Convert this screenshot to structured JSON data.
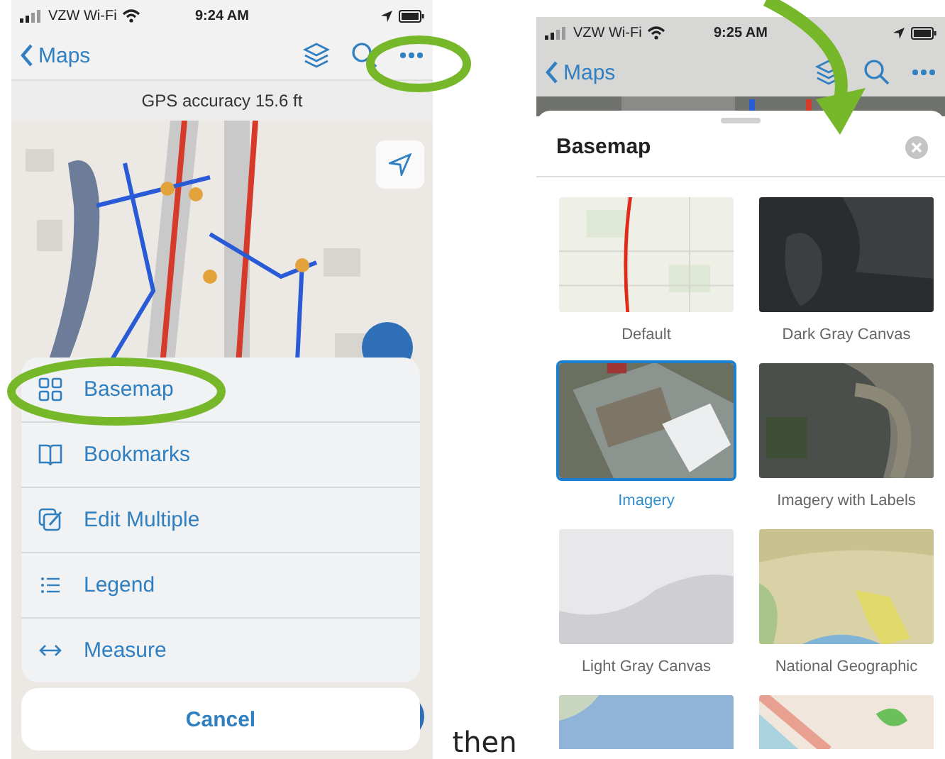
{
  "left_phone": {
    "status_bar": {
      "carrier": "VZW Wi-Fi",
      "time": "9:24 AM"
    },
    "nav_bar": {
      "back": "Maps"
    },
    "gps_banner": "GPS accuracy 15.6 ft",
    "menu": [
      {
        "label": "Basemap"
      },
      {
        "label": "Bookmarks"
      },
      {
        "label": "Edit Multiple"
      },
      {
        "label": "Legend"
      },
      {
        "label": "Measure"
      }
    ],
    "cancel": "Cancel"
  },
  "caption": "then",
  "right_phone": {
    "status_bar": {
      "carrier": "VZW Wi-Fi",
      "time": "9:25 AM"
    },
    "nav_bar": {
      "back": "Maps"
    },
    "sheet": {
      "title": "Basemap",
      "basemaps": [
        {
          "label": "Default",
          "selected": false
        },
        {
          "label": "Dark Gray Canvas",
          "selected": false
        },
        {
          "label": "Imagery",
          "selected": true
        },
        {
          "label": "Imagery with Labels",
          "selected": false
        },
        {
          "label": "Light Gray Canvas",
          "selected": false
        },
        {
          "label": "National Geographic",
          "selected": false
        },
        {
          "selected": false
        },
        {
          "selected": false
        }
      ]
    }
  },
  "annotations": [
    {
      "kind": "ellipse"
    },
    {
      "kind": "ellipse"
    },
    {
      "kind": "arrow"
    }
  ]
}
